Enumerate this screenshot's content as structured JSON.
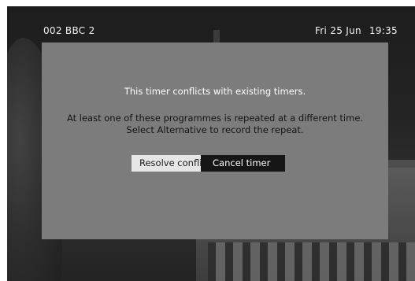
{
  "info_bar": {
    "channel": "002 BBC 2",
    "date": "Fri 25 Jun",
    "time": "19:35"
  },
  "dialog": {
    "title": "This timer conflicts with existing timers.",
    "message_lines": [
      "At least one of these programmes is repeated at a different time.",
      "Select Alternative to record the repeat."
    ],
    "buttons": {
      "resolve_label": "Resolve conflict",
      "cancel_label": "Cancel timer",
      "focused": "cancel"
    }
  },
  "colors": {
    "dialog_background": "#7c7c7c",
    "focused_button": "#161616",
    "unfocused_button": "#e6e6e6",
    "title_text": "#ffffff",
    "body_text": "#141414"
  }
}
